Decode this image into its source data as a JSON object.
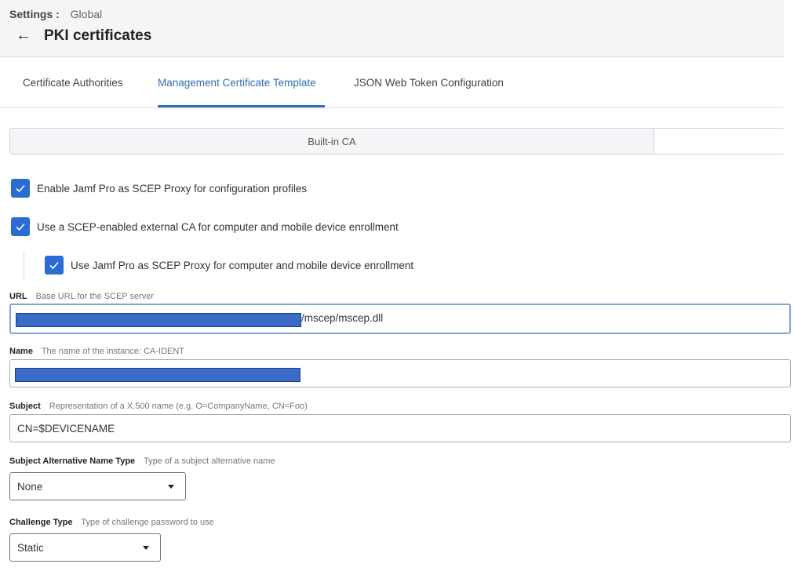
{
  "breadcrumb": {
    "section": "Settings :",
    "current": "Global"
  },
  "page": {
    "back_icon": "arrow-left-icon",
    "title": "PKI certificates"
  },
  "tabs": [
    {
      "label": "Certificate Authorities",
      "active": false
    },
    {
      "label": "Management Certificate Template",
      "active": true
    },
    {
      "label": "JSON Web Token Configuration",
      "active": false
    }
  ],
  "segmented": {
    "active_label": "Built-in CA"
  },
  "checkboxes": [
    {
      "label": "Enable Jamf Pro as SCEP Proxy for configuration profiles",
      "checked": true
    },
    {
      "label": "Use a SCEP-enabled external CA for computer and mobile device enrollment",
      "checked": true
    },
    {
      "label": "Use Jamf Pro as SCEP Proxy for computer and mobile device enrollment",
      "checked": true
    }
  ],
  "fields": {
    "url": {
      "label": "URL",
      "hint": "Base URL for the SCEP server",
      "value_suffix": "/mscep/mscep.dll"
    },
    "name": {
      "label": "Name",
      "hint": "The name of the instance: CA-IDENT"
    },
    "subject": {
      "label": "Subject",
      "hint": "Representation of a X.500 name (e.g. O=CompanyName, CN=Foo)",
      "value": "CN=$DEVICENAME"
    },
    "san_type": {
      "label": "Subject Alternative Name Type",
      "hint": "Type of a subject alternative name",
      "selected": "None"
    },
    "challenge_type": {
      "label": "Challenge Type",
      "hint": "Type of challenge password to use",
      "selected": "Static"
    }
  },
  "colors": {
    "accent": "#2f6fb5",
    "checkbox": "#2a6cd3",
    "redaction": "#3a6bc7"
  }
}
